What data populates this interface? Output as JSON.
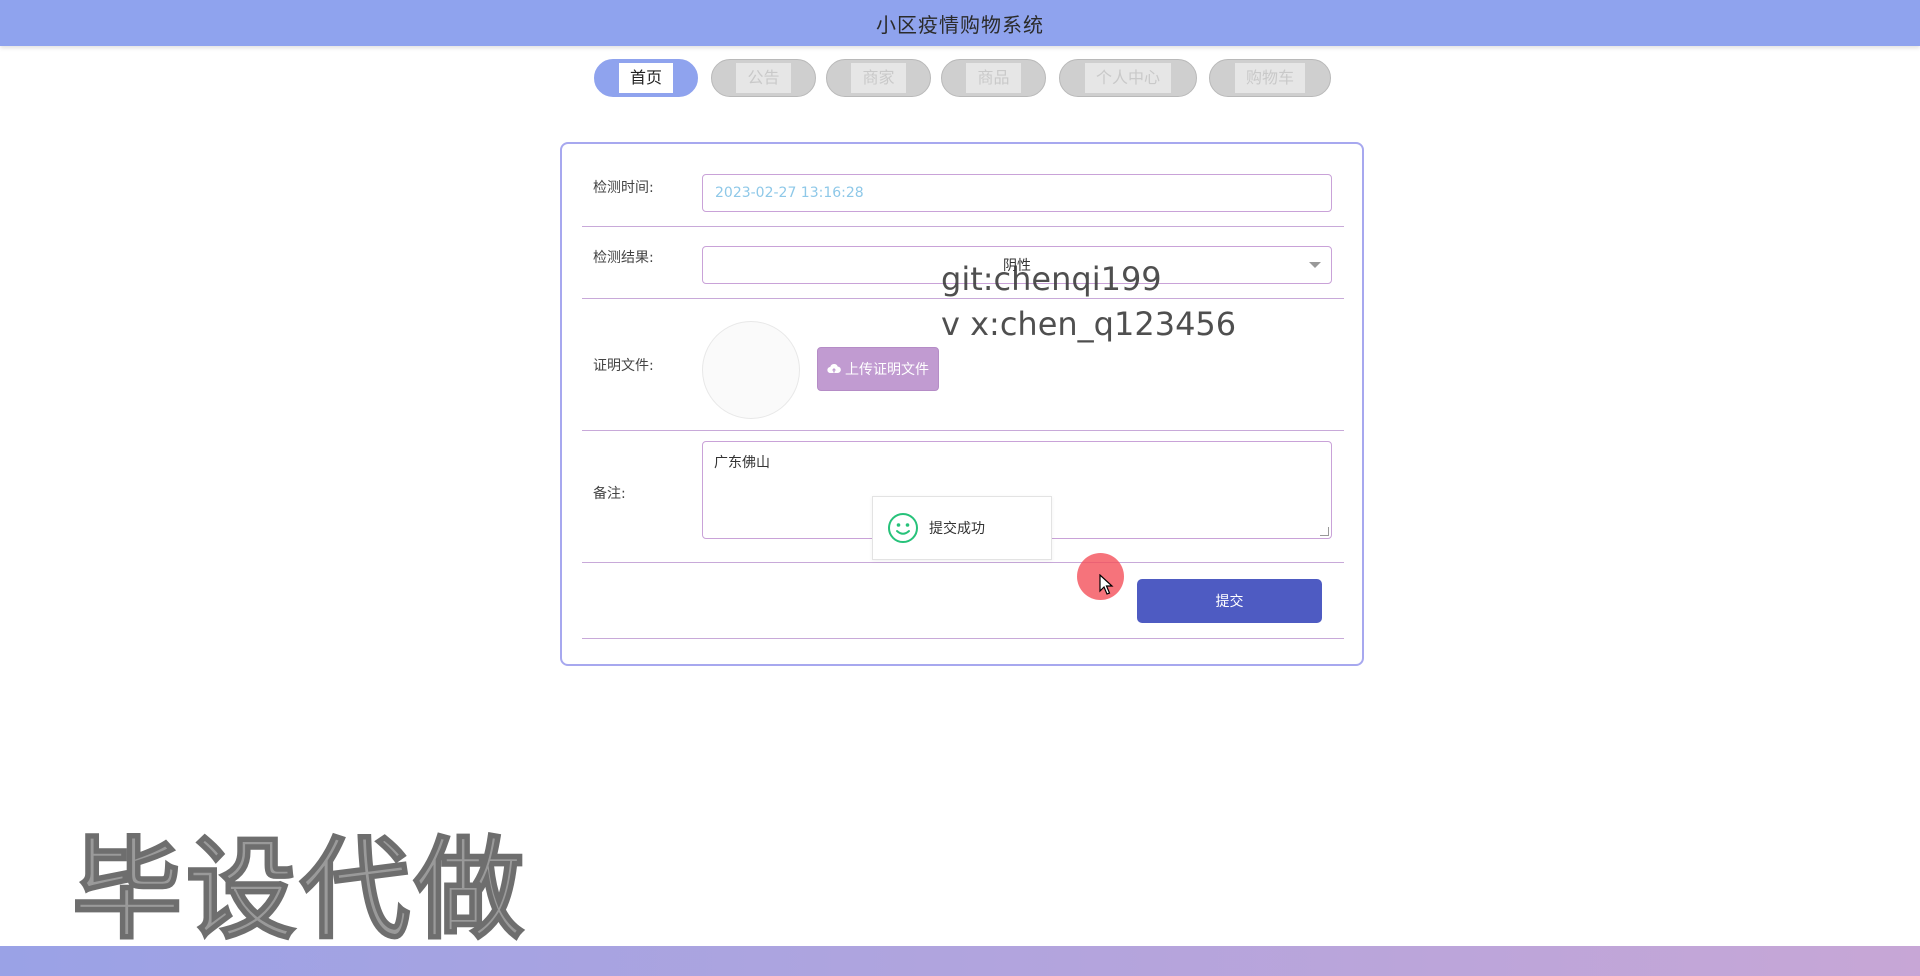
{
  "app": {
    "title": "小区疫情购物系统"
  },
  "nav": [
    {
      "label": "首页",
      "active": true
    },
    {
      "label": "公告",
      "active": false
    },
    {
      "label": "商家",
      "active": false
    },
    {
      "label": "商品",
      "active": false
    },
    {
      "label": "个人中心",
      "active": false
    },
    {
      "label": "购物车",
      "active": false
    }
  ],
  "form": {
    "time_label": "检测时间:",
    "time_value": "2023-02-27 13:16:28",
    "result_label": "检测结果:",
    "result_value": "阴性",
    "proof_label": "证明文件:",
    "upload_label": "上传证明文件",
    "remark_label": "备注:",
    "remark_value": "广东佛山",
    "submit_label": "提交"
  },
  "toast": {
    "message": "提交成功"
  },
  "watermarks": {
    "git": "git:chenqi199",
    "wechat": "v x:chen_q123456",
    "big": "毕设代做"
  },
  "colors": {
    "header": "#8fa3ee",
    "accent": "#4e5bc2",
    "upload": "#c19bd1",
    "toast_icon": "#27c27a"
  }
}
